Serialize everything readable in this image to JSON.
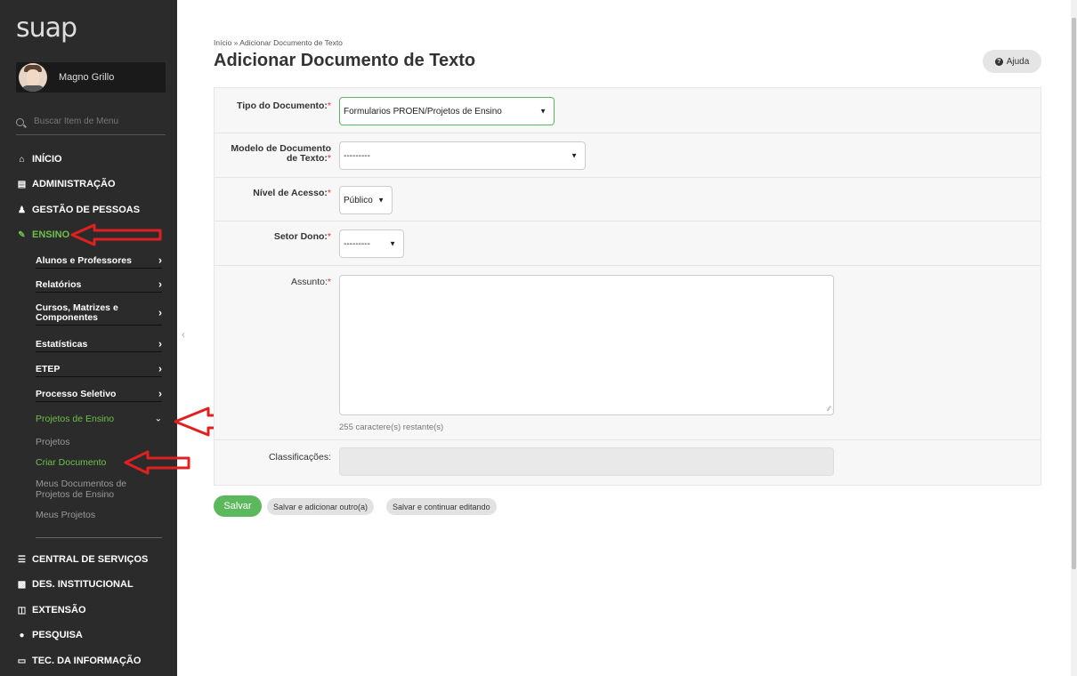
{
  "sidebar": {
    "logo": "suap",
    "user_name": "Magno Grillo",
    "search_placeholder": "Buscar Item de Menu",
    "menu": [
      {
        "label": "INÍCIO",
        "icon": "home-icon"
      },
      {
        "label": "ADMINISTRAÇÃO",
        "icon": "building-icon"
      },
      {
        "label": "GESTÃO DE PESSOAS",
        "icon": "users-icon"
      },
      {
        "label": "ENSINO",
        "icon": "pencil-icon"
      }
    ],
    "ensino_items": [
      {
        "label": "Alunos e Professores"
      },
      {
        "label": "Relatórios"
      },
      {
        "label": "Cursos, Matrizes e Componentes"
      },
      {
        "label": "Estatísticas"
      },
      {
        "label": "ETEP"
      },
      {
        "label": "Processo Seletivo"
      },
      {
        "label": "Projetos de Ensino"
      }
    ],
    "projetos_items": [
      {
        "label": "Projetos"
      },
      {
        "label": "Criar Documento"
      },
      {
        "label": "Meus Documentos de Projetos de Ensino"
      },
      {
        "label": "Meus Projetos"
      }
    ],
    "menu_bottom": [
      {
        "label": "CENTRAL DE SERVIÇOS",
        "icon": "list-icon"
      },
      {
        "label": "DES. INSTITUCIONAL",
        "icon": "bar-chart-icon"
      },
      {
        "label": "EXTENSÃO",
        "icon": "briefcase-icon"
      },
      {
        "label": "PESQUISA",
        "icon": "globe-icon"
      },
      {
        "label": "TEC. DA INFORMAÇÃO",
        "icon": "laptop-icon"
      }
    ]
  },
  "header": {
    "breadcrumb": "Início » Adicionar Documento de Texto",
    "title": "Adicionar Documento de Texto",
    "help_label": "Ajuda"
  },
  "form": {
    "tipo_label": "Tipo do Documento:",
    "tipo_value": "Formularios PROEN/Projetos de Ensino",
    "modelo_label_1": "Modelo de Documento",
    "modelo_label_2": "de Texto:",
    "modelo_value": "---------",
    "nivel_label": "Nível de Acesso:",
    "nivel_value": "Público",
    "setor_label": "Setor Dono:",
    "setor_value": "---------",
    "assunto_label": "Assunto:",
    "assunto_value": "",
    "assunto_counter": "255 caractere(s) restante(s)",
    "classificacoes_label": "Classificações:",
    "required_mark": "*"
  },
  "actions": {
    "save": "Salvar",
    "save_add": "Salvar e adicionar outro(a)",
    "save_continue": "Salvar e continuar editando"
  },
  "colors": {
    "sidebar_bg": "#2b2b2b",
    "accent_green": "#6dc04b",
    "annotation_red": "#e02020"
  }
}
